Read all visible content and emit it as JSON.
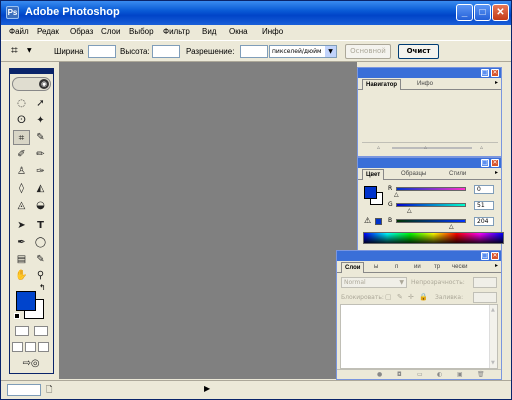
{
  "app": {
    "title": "Adobe Photoshop",
    "icon_glyph": "Ps"
  },
  "window_controls": {
    "minimize": "_",
    "maximize": "□",
    "close": "✕"
  },
  "menu": [
    "Файл",
    "Редак",
    "Образ",
    "Слои",
    "Выбор",
    "Фильтр",
    "Вид",
    "Окна",
    "Инфо"
  ],
  "options": {
    "width_label": "Ширина",
    "height_label": "Высота:",
    "resolution_label": "Разрешение:",
    "unit_value": "пикселей/дюйм",
    "front_button": "Основной",
    "clear_button": "Очист"
  },
  "navigator": {
    "tabs": [
      "Навигатор",
      "Инфо"
    ]
  },
  "color": {
    "tabs": [
      "Цвет",
      "Образцы",
      "Стили"
    ],
    "channels": [
      {
        "label": "R",
        "value": "0"
      },
      {
        "label": "G",
        "value": "51"
      },
      {
        "label": "B",
        "value": "204"
      }
    ],
    "foreground": "#0033cc",
    "background": "#ffffff"
  },
  "layers": {
    "tabs": [
      "Слои",
      "ы",
      "п",
      "ии",
      "тр",
      "чески"
    ],
    "blend_mode": "Normal",
    "opacity_label": "Непрозрачность:",
    "lock_label": "Блокировать:",
    "fill_label": "Заливка:"
  },
  "statusbar": {
    "doc_icon": "🗋",
    "arrow": "▶"
  },
  "icons": {
    "move": "move-icon",
    "marquee": "marquee-icon",
    "lasso": "lasso-icon",
    "wand": "magic-wand-icon",
    "crop": "crop-icon",
    "slice": "slice-icon"
  }
}
